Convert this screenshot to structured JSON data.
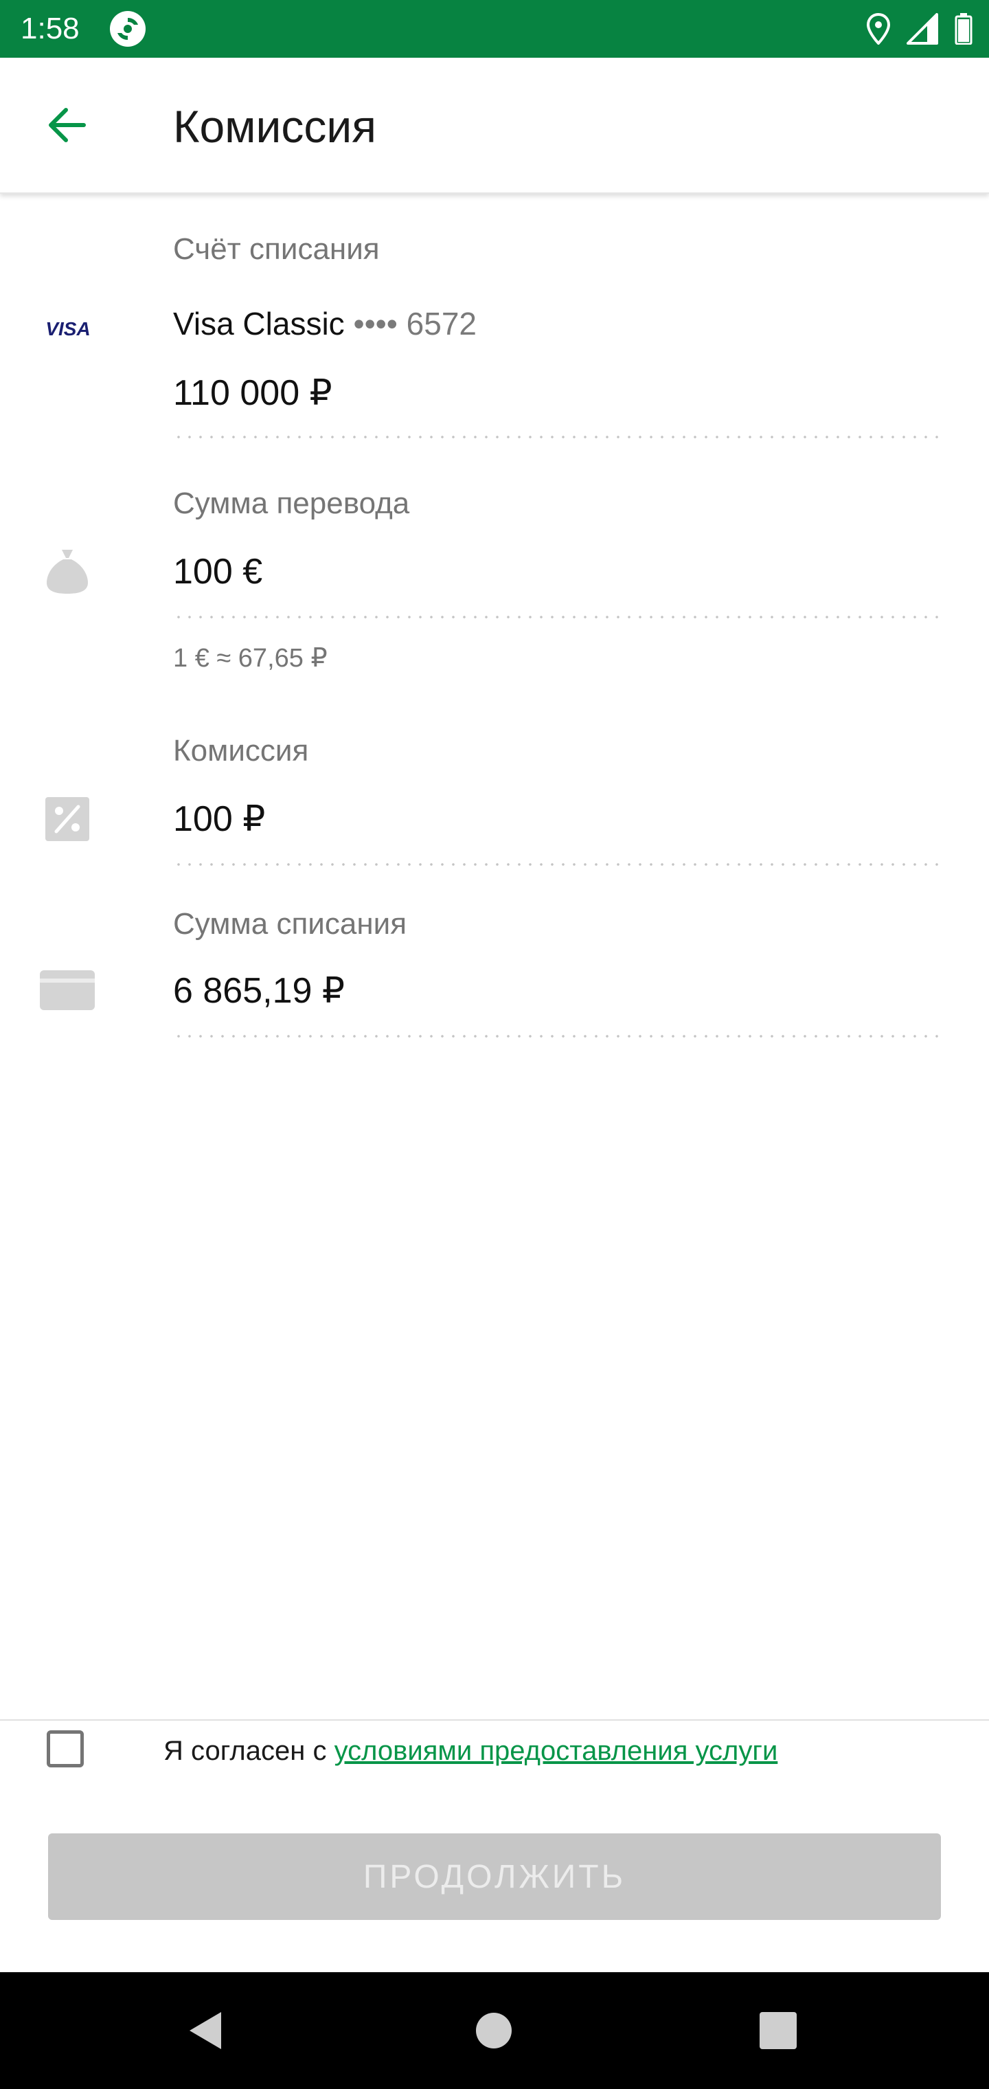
{
  "status_bar": {
    "time": "1:58",
    "icons": [
      "sync-icon",
      "location-icon",
      "signal-icon",
      "battery-icon"
    ]
  },
  "app_bar": {
    "back_icon": "arrow-left-icon",
    "title": "Комиссия"
  },
  "debit_account": {
    "label": "Счёт списания",
    "card_brand": "VISA",
    "card_name": "Visa Classic",
    "card_mask": "•••• 6572",
    "balance": "110 000 ₽"
  },
  "transfer_amount": {
    "label": "Сумма перевода",
    "icon": "money-bag-icon",
    "value": "100 €",
    "rate": "1 € ≈ 67,65 ₽"
  },
  "commission": {
    "label": "Комиссия",
    "icon": "percent-icon",
    "value": "100 ₽"
  },
  "debit_amount": {
    "label": "Сумма списания",
    "icon": "card-icon",
    "value": "6 865,19 ₽"
  },
  "agreement": {
    "text": "Я согласен с ",
    "link": "условиями предоставления услуги",
    "checked": false
  },
  "continue_button": {
    "label": "ПРОДОЛЖИТЬ",
    "enabled": false
  },
  "colors": {
    "brand_green": "#078341",
    "link_green": "#079548",
    "disabled_button": "#c6c6c6"
  }
}
